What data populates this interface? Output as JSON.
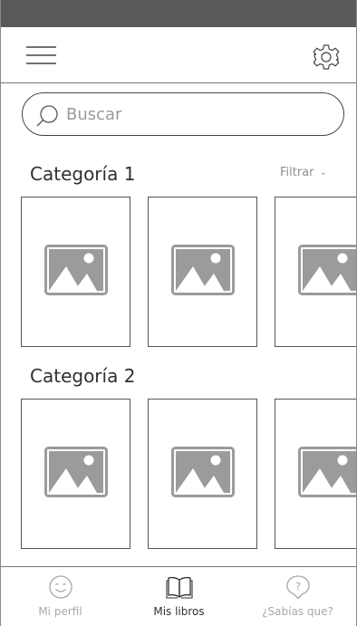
{
  "search": {
    "placeholder": "Buscar"
  },
  "categories": [
    {
      "title": "Categoría 1",
      "filter_label": "Filtrar"
    },
    {
      "title": "Categoría 2"
    }
  ],
  "bottom_nav": {
    "items": [
      {
        "label": "Mi perfil",
        "icon": "smiley-icon",
        "active": false
      },
      {
        "label": "Mis libros",
        "icon": "open-book-icon",
        "active": true
      },
      {
        "label": "¿Sabías que?",
        "icon": "question-bubble-icon",
        "active": false
      }
    ]
  },
  "colors": {
    "status_bar": "#595959",
    "placeholder_image": "#9b9b9b",
    "nav_inactive": "#a8a8a8",
    "nav_active": "#333333"
  }
}
